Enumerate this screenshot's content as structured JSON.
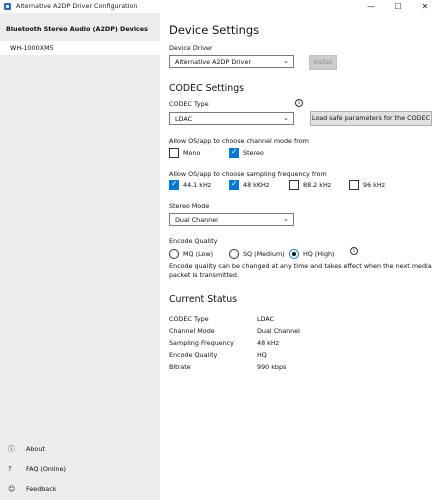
{
  "window": {
    "title": "Alternative A2DP Driver Configuration",
    "minimize": "—",
    "maximize": "☐",
    "close": "✕"
  },
  "sidebar": {
    "header": "Bluetooth Stereo Audio (A2DP) Devices",
    "device": "WH-1000XM5",
    "footer": [
      {
        "icon": "info-icon",
        "glyph": "ⓘ",
        "label": "About"
      },
      {
        "icon": "help-icon",
        "glyph": "?",
        "label": "FAQ (Online)"
      },
      {
        "icon": "feedback-icon",
        "glyph": "☺",
        "label": "Feedback"
      }
    ]
  },
  "device_settings": {
    "title": "Device Settings",
    "driver_label": "Device Driver",
    "driver_value": "Alternative A2DP Driver",
    "install_label": "Install"
  },
  "codec_settings": {
    "title": "CODEC Settings",
    "codec_type_label": "CODEC Type",
    "codec_type_value": "LDAC",
    "load_safe_label": "Load safe parameters for the CODEC",
    "channel_mode_label": "Allow OS/app to choose channel mode from",
    "channel_modes": [
      {
        "label": "Mono",
        "checked": false
      },
      {
        "label": "Stereo",
        "checked": true
      }
    ],
    "sampling_label": "Allow OS/app to choose sampling frequency from",
    "sampling_freqs": [
      {
        "label": "44.1 kHz",
        "checked": true
      },
      {
        "label": "48 kKHz",
        "checked": true
      },
      {
        "label": "88.2 kHz",
        "checked": false
      },
      {
        "label": "96 kHz",
        "checked": false
      }
    ],
    "stereo_mode_label": "Stereo Mode",
    "stereo_mode_value": "Dual Channel",
    "encode_quality_label": "Encode Quality",
    "encode_qualities": [
      {
        "label": "MQ (Low)",
        "selected": false
      },
      {
        "label": "SQ (Medium)",
        "selected": false
      },
      {
        "label": "HQ (High)",
        "selected": true
      }
    ],
    "encode_note": "Encode quality can be changed at any time and takes effect when the next media packet is transmitted."
  },
  "current_status": {
    "title": "Current Status",
    "rows": [
      {
        "key": "CODEC Type",
        "value": "LDAC"
      },
      {
        "key": "Channel Mode",
        "value": "Dual Channel"
      },
      {
        "key": "Sampling Frequency",
        "value": "48 kHz"
      },
      {
        "key": "Encode Quality",
        "value": "HQ"
      },
      {
        "key": "Bitrate",
        "value": "990 kbps"
      }
    ]
  },
  "colors": {
    "accent": "#0078d7",
    "sidebar_bg": "#ececec"
  }
}
